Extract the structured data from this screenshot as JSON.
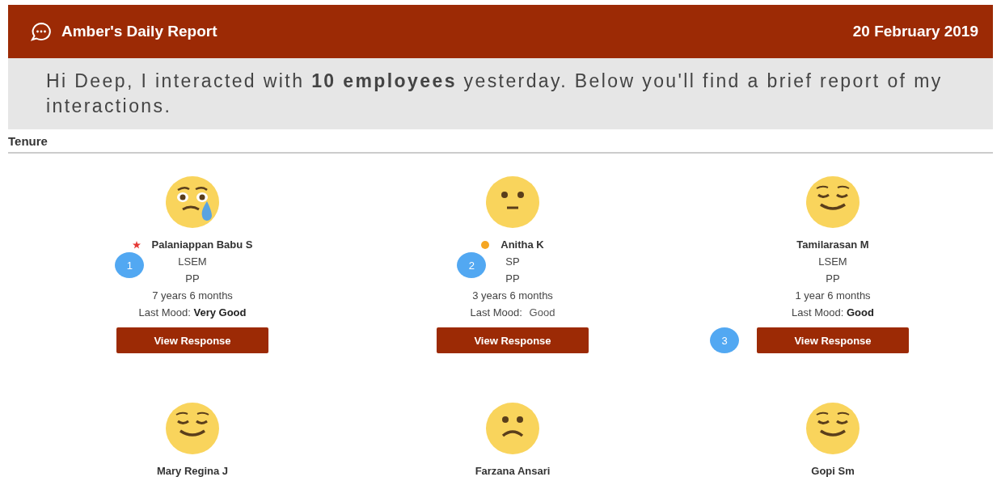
{
  "header": {
    "title": "Amber's Daily Report",
    "date": "20 February 2019"
  },
  "intro": "Hi Deep, I interacted with **10 employees** yesterday. Below you'll find a brief report of my interactions.",
  "section": "Tenure",
  "employees": [
    {
      "face": {
        "kind": "crying"
      },
      "marker": {
        "kind": "star",
        "color": "#e53935"
      },
      "name": "Palaniappan Babu S",
      "badge": "1",
      "role": "LSEM",
      "group": "PP",
      "tenure": "7 years 6 months",
      "mood_label": "Last Mood:",
      "mood": "Very Good",
      "mood_emphasized": true,
      "button": {
        "label": "View Response"
      }
    },
    {
      "face": {
        "kind": "neutral"
      },
      "marker": {
        "kind": "dot",
        "color": "#f5a623"
      },
      "name": "Anitha K",
      "badge": "2",
      "role": "SP",
      "group": "PP",
      "tenure": "3 years 6 months",
      "mood_label": "Last Mood:",
      "mood": "Good",
      "mood_emphasized": false,
      "button": {
        "label": "View Response"
      }
    },
    {
      "face": {
        "kind": "relieved"
      },
      "name": "Tamilarasan M",
      "role": "LSEM",
      "group": "PP",
      "tenure": "1 year 6 months",
      "mood_label": "Last Mood:",
      "mood": "Good",
      "mood_emphasized": true,
      "button": {
        "label": "View Response",
        "badge": "3"
      }
    },
    {
      "face": {
        "kind": "relieved"
      },
      "name": "Mary Regina J"
    },
    {
      "face": {
        "kind": "frown"
      },
      "name": "Farzana Ansari"
    },
    {
      "face": {
        "kind": "relieved"
      },
      "name": "Gopi Sm"
    }
  ]
}
